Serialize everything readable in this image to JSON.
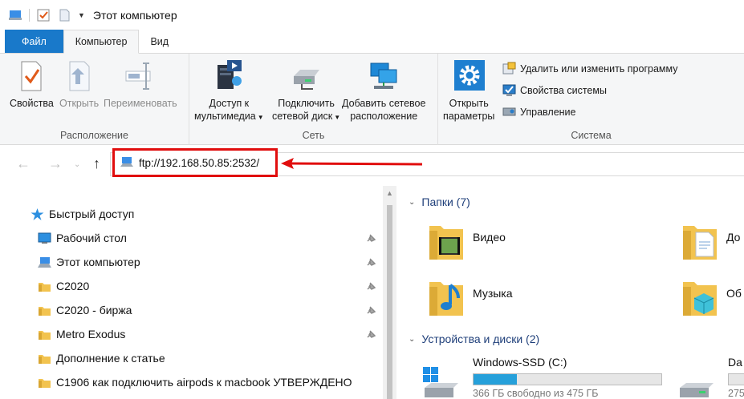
{
  "window": {
    "title": "Этот компьютер"
  },
  "tabs": {
    "file": "Файл",
    "computer": "Компьютер",
    "view": "Вид"
  },
  "ribbon": {
    "location": {
      "label": "Расположение",
      "properties": "Свойства",
      "open": "Открыть",
      "rename": "Переименовать"
    },
    "network": {
      "label": "Сеть",
      "media_line1": "Доступ к",
      "media_line2": "мультимедиа",
      "map_line1": "Подключить",
      "map_line2": "сетевой диск",
      "addnet_line1": "Добавить сетевое",
      "addnet_line2": "расположение"
    },
    "system": {
      "label": "Система",
      "params_line1": "Открыть",
      "params_line2": "параметры",
      "uninstall": "Удалить или изменить программу",
      "sysprops": "Свойства системы",
      "manage": "Управление"
    }
  },
  "address": {
    "value": "ftp://192.168.50.85:2532/"
  },
  "nav": {
    "items": [
      {
        "label": "Быстрый доступ"
      },
      {
        "label": "Рабочий стол"
      },
      {
        "label": "Этот компьютер"
      },
      {
        "label": "С2020"
      },
      {
        "label": "С2020 - биржа"
      },
      {
        "label": "Metro Exodus"
      },
      {
        "label": "Дополнение к статье"
      },
      {
        "label": "С1906 как подключить airpods к macbook УТВЕРЖДЕНО"
      }
    ]
  },
  "content": {
    "folders_header": "Папки (7)",
    "drives_header": "Устройства и диски (2)",
    "folders": [
      {
        "label": "Видео"
      },
      {
        "label": "До"
      },
      {
        "label": "Музыка"
      },
      {
        "label": "Об"
      }
    ],
    "drives": [
      {
        "name": "Windows-SSD (C:)",
        "free": "366 ГБ свободно из 475 ГБ",
        "used_fraction": 0.23
      },
      {
        "name": "Da",
        "free": "275"
      }
    ]
  },
  "colors": {
    "accent": "#1979ca",
    "highlight": "#e10e0e",
    "bar_fill": "#26a0da"
  },
  "icons": [
    "computer-icon",
    "checkbox-icon",
    "new-folder-icon",
    "properties-icon",
    "open-icon",
    "rename-icon",
    "media-server-icon",
    "map-drive-icon",
    "add-network-icon",
    "settings-gear-icon",
    "uninstall-icon",
    "system-properties-icon",
    "manage-icon",
    "back-arrow-icon",
    "forward-arrow-icon",
    "up-arrow-icon",
    "star-icon",
    "desktop-icon",
    "folder-icon",
    "pin-icon",
    "drive-icon"
  ]
}
